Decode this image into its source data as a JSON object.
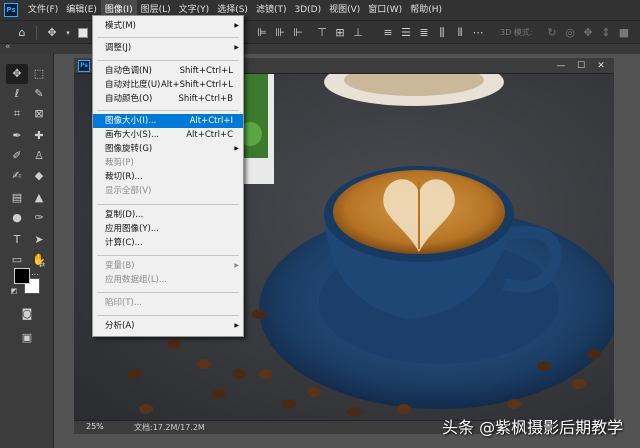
{
  "menubar": {
    "items": [
      "文件(F)",
      "编辑(E)",
      "图像(I)",
      "图层(L)",
      "文字(Y)",
      "选择(S)",
      "滤镜(T)",
      "3D(D)",
      "视图(V)",
      "窗口(W)",
      "帮助(H)"
    ]
  },
  "options": {
    "mode_label": "3D 模式:"
  },
  "image_menu": {
    "items": [
      {
        "label": "模式(M)",
        "shortcut": "",
        "submenu": true,
        "disabled": false
      },
      {
        "label": "调整(J)",
        "shortcut": "",
        "submenu": true,
        "disabled": false
      },
      {
        "label": "自动色调(N)",
        "shortcut": "Shift+Ctrl+L",
        "submenu": false,
        "disabled": false
      },
      {
        "label": "自动对比度(U)",
        "shortcut": "Alt+Shift+Ctrl+L",
        "submenu": false,
        "disabled": false
      },
      {
        "label": "自动颜色(O)",
        "shortcut": "Shift+Ctrl+B",
        "submenu": false,
        "disabled": false
      },
      {
        "label": "图像大小(I)...",
        "shortcut": "Alt+Ctrl+I",
        "submenu": false,
        "disabled": false,
        "highlighted": true
      },
      {
        "label": "画布大小(S)...",
        "shortcut": "Alt+Ctrl+C",
        "submenu": false,
        "disabled": false
      },
      {
        "label": "图像旋转(G)",
        "shortcut": "",
        "submenu": true,
        "disabled": false
      },
      {
        "label": "裁剪(P)",
        "shortcut": "",
        "submenu": false,
        "disabled": true
      },
      {
        "label": "裁切(R)...",
        "shortcut": "",
        "submenu": false,
        "disabled": false
      },
      {
        "label": "显示全部(V)",
        "shortcut": "",
        "submenu": false,
        "disabled": true
      },
      {
        "label": "复制(D)...",
        "shortcut": "",
        "submenu": false,
        "disabled": false
      },
      {
        "label": "应用图像(Y)...",
        "shortcut": "",
        "submenu": false,
        "disabled": false
      },
      {
        "label": "计算(C)...",
        "shortcut": "",
        "submenu": false,
        "disabled": false
      },
      {
        "label": "变量(B)",
        "shortcut": "",
        "submenu": true,
        "disabled": true
      },
      {
        "label": "应用数据组(L)...",
        "shortcut": "",
        "submenu": false,
        "disabled": true
      },
      {
        "label": "陷印(T)...",
        "shortcut": "",
        "submenu": false,
        "disabled": true
      },
      {
        "label": "分析(A)",
        "shortcut": "",
        "submenu": true,
        "disabled": false
      }
    ]
  },
  "status": {
    "zoom": "25%",
    "doc_info": "文档:17.2M/17.2M"
  },
  "watermark": "头条 @紫枫摄影后期教学",
  "colors": {
    "highlight": "#0078d7",
    "menubar": "#323232",
    "workspace": "#535353"
  }
}
